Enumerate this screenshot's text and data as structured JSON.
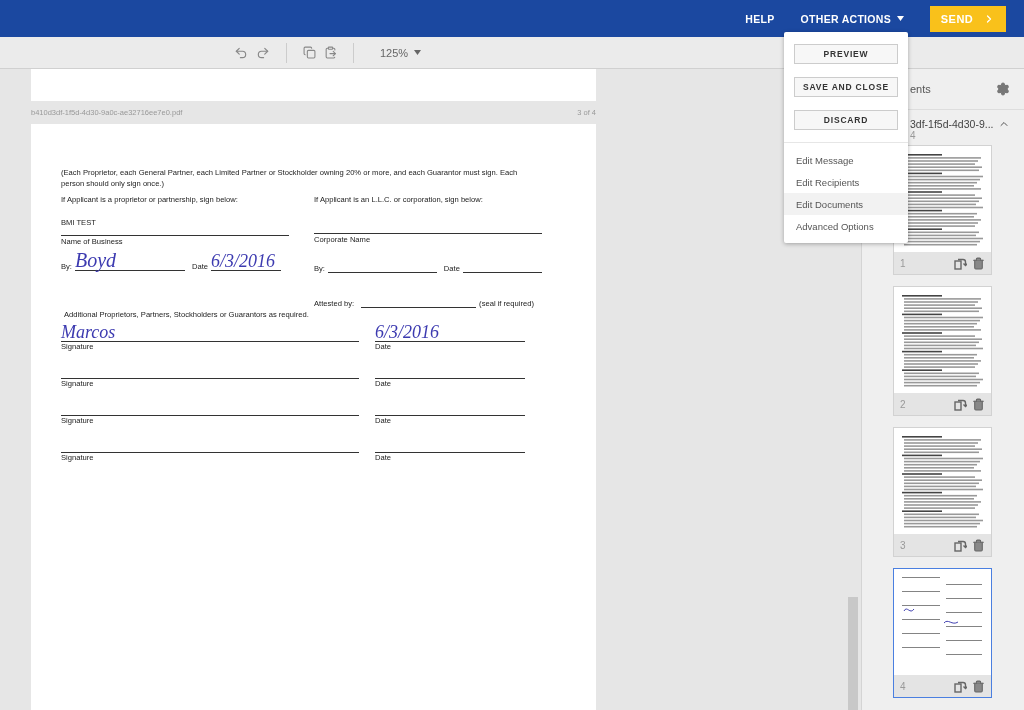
{
  "topbar": {
    "links": [
      {
        "label": "HELP",
        "kind": "plain"
      },
      {
        "label": "OTHER ACTIONS",
        "kind": "dropdown"
      }
    ],
    "send_button": "SEND"
  },
  "toolbar": {
    "zoom": "125%"
  },
  "viewer": {
    "file_name": "b410d3df-1f5d-4d30-9a0c-ae32716ee7e0.pdf",
    "page_counter": "3 of 4",
    "document": {
      "intro": "(Each Proprietor, each General Partner, each Limited Partner or Stockholder owning 20% or more, and each Guarantor must sign. Each person should only sign once.)",
      "left": {
        "heading": "If Applicant is a proprietor or partnership, sign below:",
        "business": "BMI TEST",
        "business_label": "Name of Business",
        "by_label": "By:",
        "signature": "Boyd",
        "date_label": "Date",
        "date": "6/3/2016"
      },
      "right": {
        "heading": "If Applicant is an L.L.C. or corporation, sign below:",
        "name_label": "Corporate Name",
        "by_label": "By:",
        "date_label": "Date",
        "attested_label": "Attested by:",
        "seal_label": "(seal if required)"
      },
      "additional": "Additional Proprietors, Partners, Stockholders or Guarantors as required.",
      "rows": [
        {
          "signature_label": "Signature",
          "signature": "Marcos",
          "date_label": "Date",
          "date": "6/3/2016"
        },
        {
          "signature_label": "Signature",
          "date_label": "Date"
        },
        {
          "signature_label": "Signature",
          "date_label": "Date"
        },
        {
          "signature_label": "Signature",
          "date_label": "Date"
        }
      ]
    }
  },
  "menu": {
    "buttons": [
      "PREVIEW",
      "SAVE AND CLOSE",
      "DISCARD"
    ],
    "items": [
      {
        "label": "Edit Message",
        "selected": false
      },
      {
        "label": "Edit Recipients",
        "selected": false
      },
      {
        "label": "Edit Documents",
        "selected": true
      },
      {
        "label": "Advanced Options",
        "selected": false
      }
    ]
  },
  "panel": {
    "title": "ents",
    "document_name": "3df-1f5d-4d30-9...",
    "page_count": "4",
    "expanded": true,
    "pages": [
      {
        "number": "1",
        "selected": false,
        "kind": "text"
      },
      {
        "number": "2",
        "selected": false,
        "kind": "text"
      },
      {
        "number": "3",
        "selected": false,
        "kind": "text"
      },
      {
        "number": "4",
        "selected": true,
        "kind": "form"
      }
    ]
  }
}
